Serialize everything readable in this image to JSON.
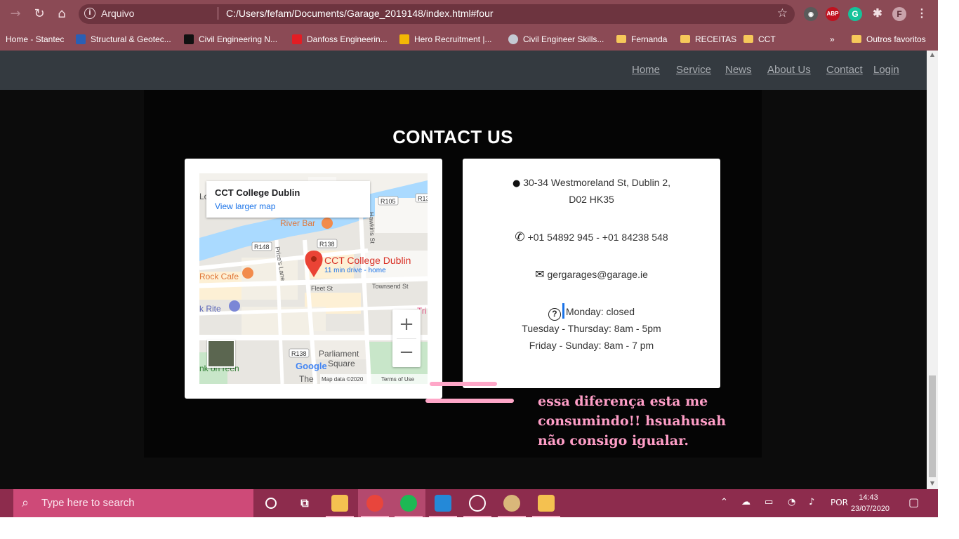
{
  "browser": {
    "scheme_label": "Arquivo",
    "url": "C:/Users/fefam/Documents/Garage_2019148/index.html#four",
    "profile_initial": "F",
    "ext_abp": "ABP",
    "ext_grammarly": "G",
    "bookmarks": [
      {
        "label": "Home - Stantec"
      },
      {
        "label": "Structural & Geotec..."
      },
      {
        "label": "Civil Engineering N..."
      },
      {
        "label": "Danfoss Engineerin..."
      },
      {
        "label": "Hero Recruitment |..."
      },
      {
        "label": "Civil Engineer Skills..."
      },
      {
        "label": "Fernanda"
      },
      {
        "label": "RECEITAS"
      },
      {
        "label": "CCT"
      }
    ],
    "more_bookmarks": "»",
    "other_bookmarks": "Outros favoritos"
  },
  "nav": {
    "links": [
      "Home",
      "Service",
      "News",
      "About Us",
      "Contact",
      "Login"
    ]
  },
  "contact": {
    "title": "CONTACT US",
    "address_line1": "30-34 Westmoreland St, Dublin 2,",
    "address_line2": "D02 HK35",
    "phone": "+01 54892 945 - +01 84238 548",
    "email": "gergarages@garage.ie",
    "hours_line1": "Monday: closed",
    "hours_line2": "Tuesday - Thursday: 8am - 5pm",
    "hours_line3": "Friday - Sunday: 8am - 7 pm"
  },
  "map": {
    "popup_title": "CCT College Dublin",
    "popup_link": "View larger map",
    "pin_title": "CCT College Dublin",
    "pin_sub": "11 min drive - home",
    "labels": {
      "river_bar": "River Bar",
      "rock_cafe": "Rock Cafe",
      "rite": "k Rite",
      "fleet": "Fleet St",
      "townsend": "Townsend St",
      "prices": "Price's Lane",
      "hawkins": "Hawkins St",
      "parliament1": "Parliament",
      "parliament2": "Square",
      "green": "nk on\nreen",
      "the": "The",
      "tri": "Tri",
      "lo": "Lo"
    },
    "roads": [
      "R105",
      "R13",
      "R138",
      "R148",
      "R138"
    ],
    "attribution": "Map data ©2020",
    "terms": "Terms of Use",
    "logo": "Google",
    "zoom_in": "+",
    "zoom_out": "−"
  },
  "annotation": {
    "line1": "essa diferença esta me",
    "line2": "consumindo!! hsuahusah",
    "line3": "não consigo igualar."
  },
  "taskbar": {
    "search_placeholder": "Type here to search",
    "language": "POR",
    "time": "14:43",
    "date": "23/07/2020"
  },
  "colors": {
    "chrome": "#8b4a55",
    "navbar": "#343a40",
    "taskbar": "#8d2c4d",
    "note": "#ff9ec7"
  }
}
